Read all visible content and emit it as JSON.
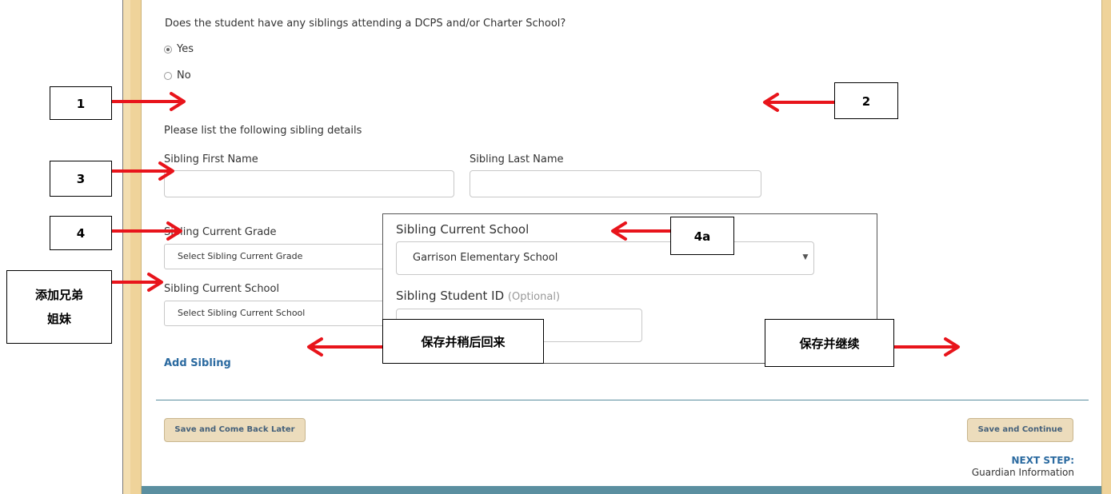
{
  "form": {
    "sibling_question": "Does the student have any siblings attending a DCPS and/or Charter School?",
    "option_yes": "Yes",
    "option_no": "No",
    "details_prompt": "Please list the following sibling details",
    "first_name_label": "Sibling First Name",
    "first_name_value": "",
    "last_name_label": "Sibling Last Name",
    "last_name_value": "",
    "grade_label": "Sibling Current Grade",
    "grade_placeholder": "Select Sibling Current Grade",
    "school_label": "Sibling Current School",
    "school_placeholder": "Select Sibling Current School",
    "add_sibling": "Add Sibling",
    "save_later": "Save and Come Back Later",
    "save_continue": "Save and Continue",
    "next_step_label": "NEXT STEP:",
    "next_step_value": "Guardian Information"
  },
  "zoom": {
    "school_label": "Sibling Current School",
    "school_value": "Garrison Elementary School",
    "student_id_label": "Sibling Student ID",
    "student_id_optional": "(Optional)",
    "student_id_value": ""
  },
  "callouts": {
    "c1": "1",
    "c2": "2",
    "c3": "3",
    "c4": "4",
    "c4a": "4a",
    "add_sibling_cn_line1": "添加兄弟",
    "add_sibling_cn_line2": "姐妹",
    "save_later_cn": "保存并稍后回来",
    "save_continue_cn": "保存并继续"
  },
  "colors": {
    "accent_gold": "#efd39a",
    "link_blue": "#2b6aa0",
    "arrow_red": "#e8141b",
    "divider": "#5b8fa0"
  }
}
